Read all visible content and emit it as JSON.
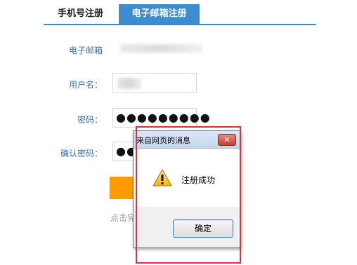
{
  "tabs": [
    {
      "label": "手机号注册",
      "active": false
    },
    {
      "label": "电子邮箱注册",
      "active": true
    }
  ],
  "form": {
    "email_label": "电子邮箱",
    "username_label": "用户名：",
    "password_label": "密码：",
    "password_value": "●●●●●●●●●",
    "confirm_label": "确认密码：",
    "confirm_value": "●●●●",
    "hint_text": "点击完"
  },
  "dialog": {
    "title": "来自网页的消息",
    "close_label": "✕",
    "icon": "warning-icon",
    "message": "注册成功",
    "ok_label": "确定"
  },
  "colors": {
    "tab_active": "#3d8cd0",
    "label_blue": "#3a6fb0",
    "submit_orange": "#ff9a00",
    "highlight_red": "#d9313d"
  }
}
